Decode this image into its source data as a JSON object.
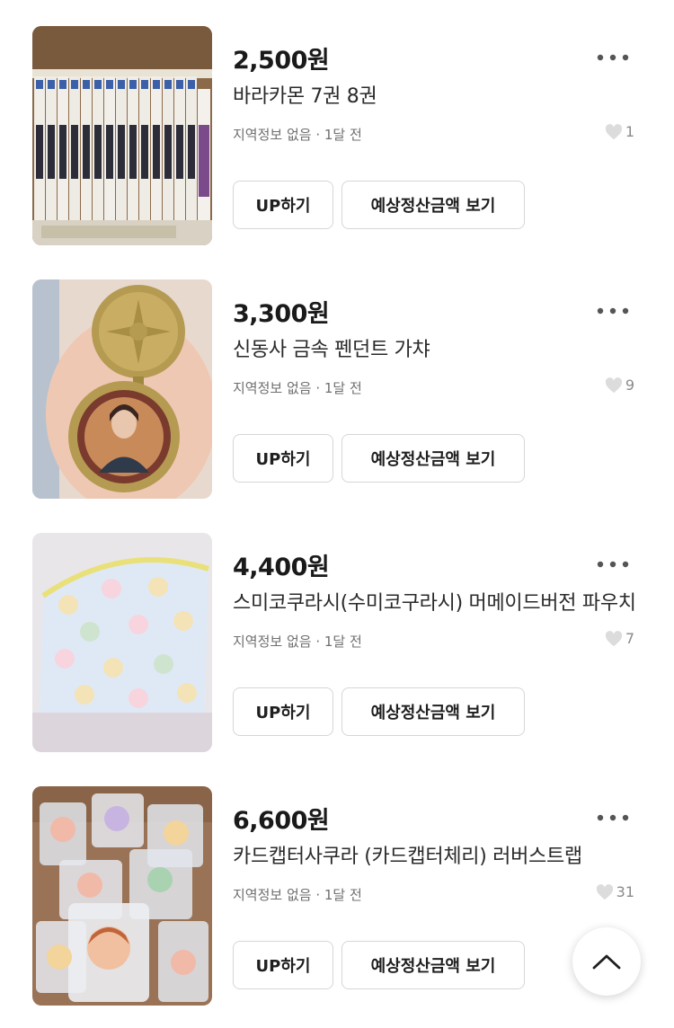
{
  "listings": [
    {
      "price": "2,500원",
      "title": "바라카몬 7권 8권",
      "meta": "지역정보 없음 · 1달 전",
      "likes": "1",
      "up_label": "UP하기",
      "estimate_label": "예상정산금액 보기",
      "image": "manga-books-photo"
    },
    {
      "price": "3,300원",
      "title": "신동사 금속 펜던트 가챠",
      "meta": "지역정보 없음 · 1달 전",
      "likes": "9",
      "up_label": "UP하기",
      "estimate_label": "예상정산금액 보기",
      "image": "metal-pendant-photo"
    },
    {
      "price": "4,400원",
      "title": "스미코쿠라시(수미코구라시) 머메이드버전 파우치",
      "meta": "지역정보 없음 · 1달 전",
      "likes": "7",
      "up_label": "UP하기",
      "estimate_label": "예상정산금액 보기",
      "image": "sumikko-pouch-photo"
    },
    {
      "price": "6,600원",
      "title": "카드캡터사쿠라 (카드캡터체리) 러버스트랩",
      "meta": "지역정보 없음 · 1달 전",
      "likes": "31",
      "up_label": "UP하기",
      "estimate_label": "예상정산금액 보기",
      "image": "rubber-strap-photo"
    }
  ],
  "icons": {
    "more": "more-dots-icon",
    "like": "heart-icon",
    "scroll_top": "chevron-up-icon"
  },
  "colors": {
    "text": "#1f1f1f",
    "muted": "#6f6f6f",
    "border": "#d6d6d6",
    "heart": "#dcdcdc"
  }
}
